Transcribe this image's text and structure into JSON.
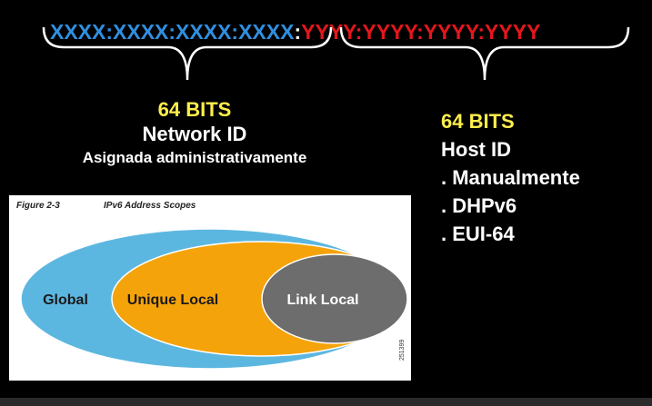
{
  "address": {
    "network_part": "XXXX:XXXX:XXXX:XXXX",
    "separator": ":",
    "host_part": "YYYY:YYYY:YYYY:YYYY"
  },
  "network": {
    "bits": "64 BITS",
    "title": "Network ID",
    "assignment": "Asignada administrativamente"
  },
  "host": {
    "bits": "64 BITS",
    "title": "Host ID",
    "methods": [
      ". Manualmente",
      ". DHPv6",
      ". EUI-64"
    ]
  },
  "figure": {
    "number": "Figure 2-3",
    "title": "IPv6 Address Scopes",
    "scopes": {
      "global": "Global",
      "unique_local": "Unique Local",
      "link_local": "Link Local"
    },
    "code": "251399",
    "colors": {
      "global": "#5cb7e0",
      "unique_local": "#f5a30b",
      "link_local": "#6d6d6d"
    }
  },
  "colors": {
    "network": "#2f8fe0",
    "host": "#e4161d",
    "highlight": "#ffee4a",
    "background": "#000000"
  }
}
